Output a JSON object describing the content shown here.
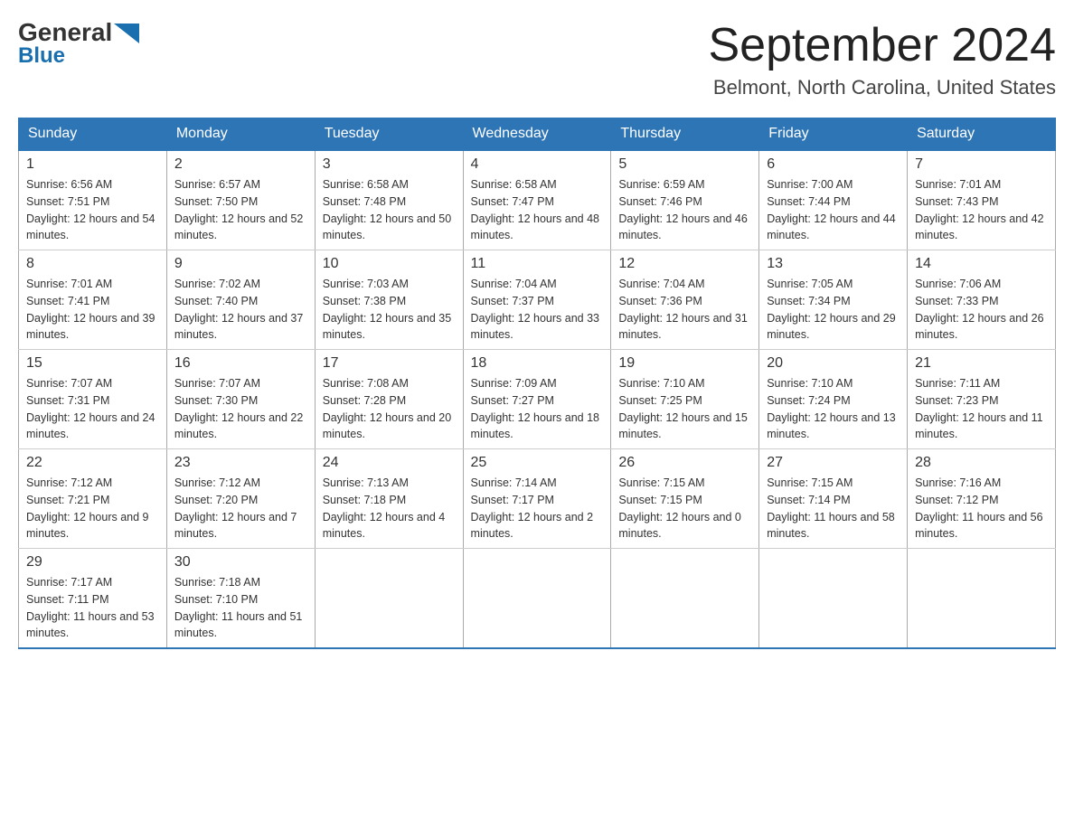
{
  "logo": {
    "general": "General",
    "blue": "Blue"
  },
  "title": "September 2024",
  "subtitle": "Belmont, North Carolina, United States",
  "headers": [
    "Sunday",
    "Monday",
    "Tuesday",
    "Wednesday",
    "Thursday",
    "Friday",
    "Saturday"
  ],
  "weeks": [
    [
      {
        "day": "1",
        "sunrise": "6:56 AM",
        "sunset": "7:51 PM",
        "daylight": "12 hours and 54 minutes."
      },
      {
        "day": "2",
        "sunrise": "6:57 AM",
        "sunset": "7:50 PM",
        "daylight": "12 hours and 52 minutes."
      },
      {
        "day": "3",
        "sunrise": "6:58 AM",
        "sunset": "7:48 PM",
        "daylight": "12 hours and 50 minutes."
      },
      {
        "day": "4",
        "sunrise": "6:58 AM",
        "sunset": "7:47 PM",
        "daylight": "12 hours and 48 minutes."
      },
      {
        "day": "5",
        "sunrise": "6:59 AM",
        "sunset": "7:46 PM",
        "daylight": "12 hours and 46 minutes."
      },
      {
        "day": "6",
        "sunrise": "7:00 AM",
        "sunset": "7:44 PM",
        "daylight": "12 hours and 44 minutes."
      },
      {
        "day": "7",
        "sunrise": "7:01 AM",
        "sunset": "7:43 PM",
        "daylight": "12 hours and 42 minutes."
      }
    ],
    [
      {
        "day": "8",
        "sunrise": "7:01 AM",
        "sunset": "7:41 PM",
        "daylight": "12 hours and 39 minutes."
      },
      {
        "day": "9",
        "sunrise": "7:02 AM",
        "sunset": "7:40 PM",
        "daylight": "12 hours and 37 minutes."
      },
      {
        "day": "10",
        "sunrise": "7:03 AM",
        "sunset": "7:38 PM",
        "daylight": "12 hours and 35 minutes."
      },
      {
        "day": "11",
        "sunrise": "7:04 AM",
        "sunset": "7:37 PM",
        "daylight": "12 hours and 33 minutes."
      },
      {
        "day": "12",
        "sunrise": "7:04 AM",
        "sunset": "7:36 PM",
        "daylight": "12 hours and 31 minutes."
      },
      {
        "day": "13",
        "sunrise": "7:05 AM",
        "sunset": "7:34 PM",
        "daylight": "12 hours and 29 minutes."
      },
      {
        "day": "14",
        "sunrise": "7:06 AM",
        "sunset": "7:33 PM",
        "daylight": "12 hours and 26 minutes."
      }
    ],
    [
      {
        "day": "15",
        "sunrise": "7:07 AM",
        "sunset": "7:31 PM",
        "daylight": "12 hours and 24 minutes."
      },
      {
        "day": "16",
        "sunrise": "7:07 AM",
        "sunset": "7:30 PM",
        "daylight": "12 hours and 22 minutes."
      },
      {
        "day": "17",
        "sunrise": "7:08 AM",
        "sunset": "7:28 PM",
        "daylight": "12 hours and 20 minutes."
      },
      {
        "day": "18",
        "sunrise": "7:09 AM",
        "sunset": "7:27 PM",
        "daylight": "12 hours and 18 minutes."
      },
      {
        "day": "19",
        "sunrise": "7:10 AM",
        "sunset": "7:25 PM",
        "daylight": "12 hours and 15 minutes."
      },
      {
        "day": "20",
        "sunrise": "7:10 AM",
        "sunset": "7:24 PM",
        "daylight": "12 hours and 13 minutes."
      },
      {
        "day": "21",
        "sunrise": "7:11 AM",
        "sunset": "7:23 PM",
        "daylight": "12 hours and 11 minutes."
      }
    ],
    [
      {
        "day": "22",
        "sunrise": "7:12 AM",
        "sunset": "7:21 PM",
        "daylight": "12 hours and 9 minutes."
      },
      {
        "day": "23",
        "sunrise": "7:12 AM",
        "sunset": "7:20 PM",
        "daylight": "12 hours and 7 minutes."
      },
      {
        "day": "24",
        "sunrise": "7:13 AM",
        "sunset": "7:18 PM",
        "daylight": "12 hours and 4 minutes."
      },
      {
        "day": "25",
        "sunrise": "7:14 AM",
        "sunset": "7:17 PM",
        "daylight": "12 hours and 2 minutes."
      },
      {
        "day": "26",
        "sunrise": "7:15 AM",
        "sunset": "7:15 PM",
        "daylight": "12 hours and 0 minutes."
      },
      {
        "day": "27",
        "sunrise": "7:15 AM",
        "sunset": "7:14 PM",
        "daylight": "11 hours and 58 minutes."
      },
      {
        "day": "28",
        "sunrise": "7:16 AM",
        "sunset": "7:12 PM",
        "daylight": "11 hours and 56 minutes."
      }
    ],
    [
      {
        "day": "29",
        "sunrise": "7:17 AM",
        "sunset": "7:11 PM",
        "daylight": "11 hours and 53 minutes."
      },
      {
        "day": "30",
        "sunrise": "7:18 AM",
        "sunset": "7:10 PM",
        "daylight": "11 hours and 51 minutes."
      },
      null,
      null,
      null,
      null,
      null
    ]
  ]
}
